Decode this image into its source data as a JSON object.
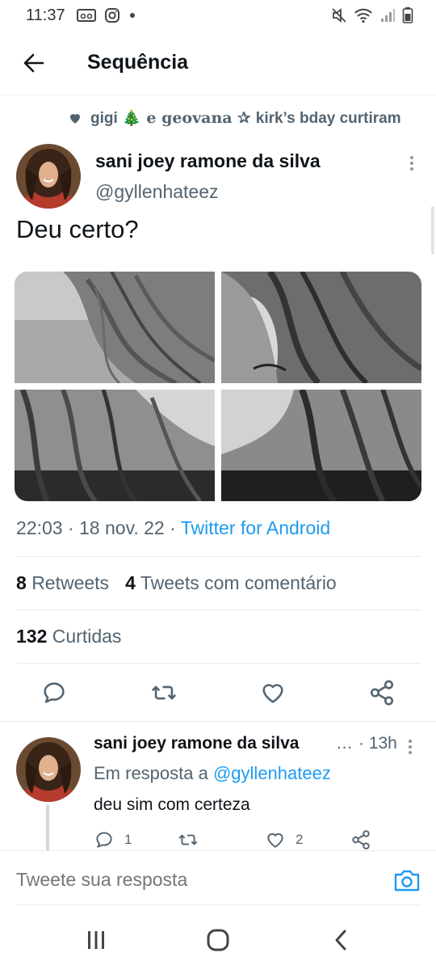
{
  "status_bar": {
    "time": "11:37",
    "left_icons": [
      "voicemail-icon",
      "instagram-icon",
      "dot-icon"
    ],
    "right_icons": [
      "mute-icon",
      "wifi-icon",
      "signal-icon",
      "battery-icon"
    ]
  },
  "header": {
    "title": "Sequência",
    "back_icon": "arrow-left-icon"
  },
  "social_context": {
    "names_a": "gigi 🎄",
    "conj": "e",
    "names_b": "geovana ✰",
    "rest": "kirk’s bday curtiram"
  },
  "tweet": {
    "author_name": "sani joey ramone da silva",
    "handle": "@gyllenhateez",
    "text": "Deu certo?",
    "time": "22:03",
    "date": "18 nov. 22",
    "sep": "·",
    "client": "Twitter for Android",
    "retweets_count": "8",
    "retweets_label": "Retweets",
    "quotes_count": "4",
    "quotes_label": "Tweets com comentário",
    "likes_count": "132",
    "likes_label": "Curtidas",
    "actions": [
      "reply-icon",
      "retweet-icon",
      "like-icon",
      "share-icon"
    ]
  },
  "reply": {
    "author_name": "sani joey ramone da silva",
    "ellipsis": "…",
    "time": "· 13h",
    "in_reply_prefix": "Em resposta a",
    "in_reply_handle": "@gyllenhateez",
    "text": "deu sim com certeza",
    "reply_count": "1",
    "retweet_count": "",
    "like_count": "2"
  },
  "composer": {
    "placeholder": "Tweete sua resposta"
  },
  "colors": {
    "accent": "#1d9bf0",
    "secondary_text": "#536471",
    "primary_text": "#0f1419"
  }
}
